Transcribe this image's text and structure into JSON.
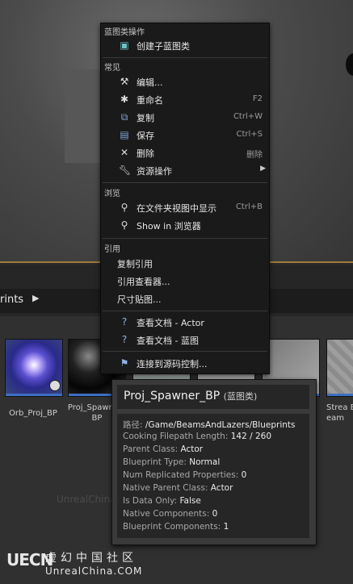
{
  "content_browser": {
    "path_label": "rints",
    "assets": [
      {
        "name": "Orb_Proj_BP"
      },
      {
        "name": "Proj_Spawner_BP"
      },
      {
        "name": "Strea Beam"
      }
    ]
  },
  "context_menu": {
    "sections": [
      {
        "title": "蓝图类操作",
        "items": [
          {
            "label": "创建子蓝图类",
            "icon": "blueprint-child-icon",
            "shortcut": ""
          }
        ]
      },
      {
        "title": "常见",
        "items": [
          {
            "label": "编辑...",
            "icon": "hammer-icon",
            "shortcut": ""
          },
          {
            "label": "重命名",
            "icon": "rename-icon",
            "shortcut": "F2"
          },
          {
            "label": "复制",
            "icon": "duplicate-icon",
            "shortcut": "Ctrl+W"
          },
          {
            "label": "保存",
            "icon": "save-icon",
            "shortcut": "Ctrl+S"
          },
          {
            "label": "删除",
            "icon": "delete-icon",
            "shortcut": "删除"
          },
          {
            "label": "资源操作",
            "icon": "wrench-icon",
            "shortcut": "",
            "submenu": true
          }
        ]
      },
      {
        "title": "浏览",
        "items": [
          {
            "label": "在文件夹视图中显示",
            "icon": "magnifier-icon",
            "shortcut": "Ctrl+B"
          },
          {
            "label": "Show in 浏览器",
            "icon": "magnifier-icon",
            "shortcut": ""
          }
        ]
      },
      {
        "title": "引用",
        "items": [
          {
            "label": "复制引用",
            "icon": "",
            "shortcut": ""
          },
          {
            "label": "引用查看器...",
            "icon": "",
            "shortcut": ""
          },
          {
            "label": "尺寸贴图...",
            "icon": "",
            "shortcut": ""
          }
        ]
      },
      {
        "title": "",
        "items": [
          {
            "label": "查看文档 - Actor",
            "icon": "help-icon",
            "shortcut": ""
          },
          {
            "label": "查看文档 - 蓝图",
            "icon": "help-icon",
            "shortcut": ""
          }
        ]
      },
      {
        "title": "",
        "items": [
          {
            "label": "连接到源码控制...",
            "icon": "source-control-icon",
            "shortcut": ""
          }
        ]
      }
    ]
  },
  "tooltip": {
    "title": "Proj_Spawner_BP",
    "type": "(蓝图类)",
    "rows": [
      {
        "key": "路径: ",
        "value": "/Game/BeamsAndLazers/Blueprints"
      },
      {
        "key": "Cooking Filepath Length: ",
        "value": "142 / 260"
      },
      {
        "key": "Parent Class: ",
        "value": "Actor"
      },
      {
        "key": "Blueprint Type: ",
        "value": "Normal"
      },
      {
        "key": "Num Replicated Properties: ",
        "value": "0"
      },
      {
        "key": "Native Parent Class: ",
        "value": "Actor"
      },
      {
        "key": "Is Data Only: ",
        "value": "False"
      },
      {
        "key": "Native Components: ",
        "value": "0"
      },
      {
        "key": "Blueprint Components: ",
        "value": "1"
      }
    ]
  },
  "watermark": {
    "logo": "UECN",
    "cn": "虚幻中国社区",
    "en": "UnrealChina.COM",
    "faint": "UnrealChina"
  },
  "colors": {
    "accent_bar": "#3d6fc4",
    "viewport_line": "#a07a3a",
    "menu_bg": "#1a1a1a"
  }
}
